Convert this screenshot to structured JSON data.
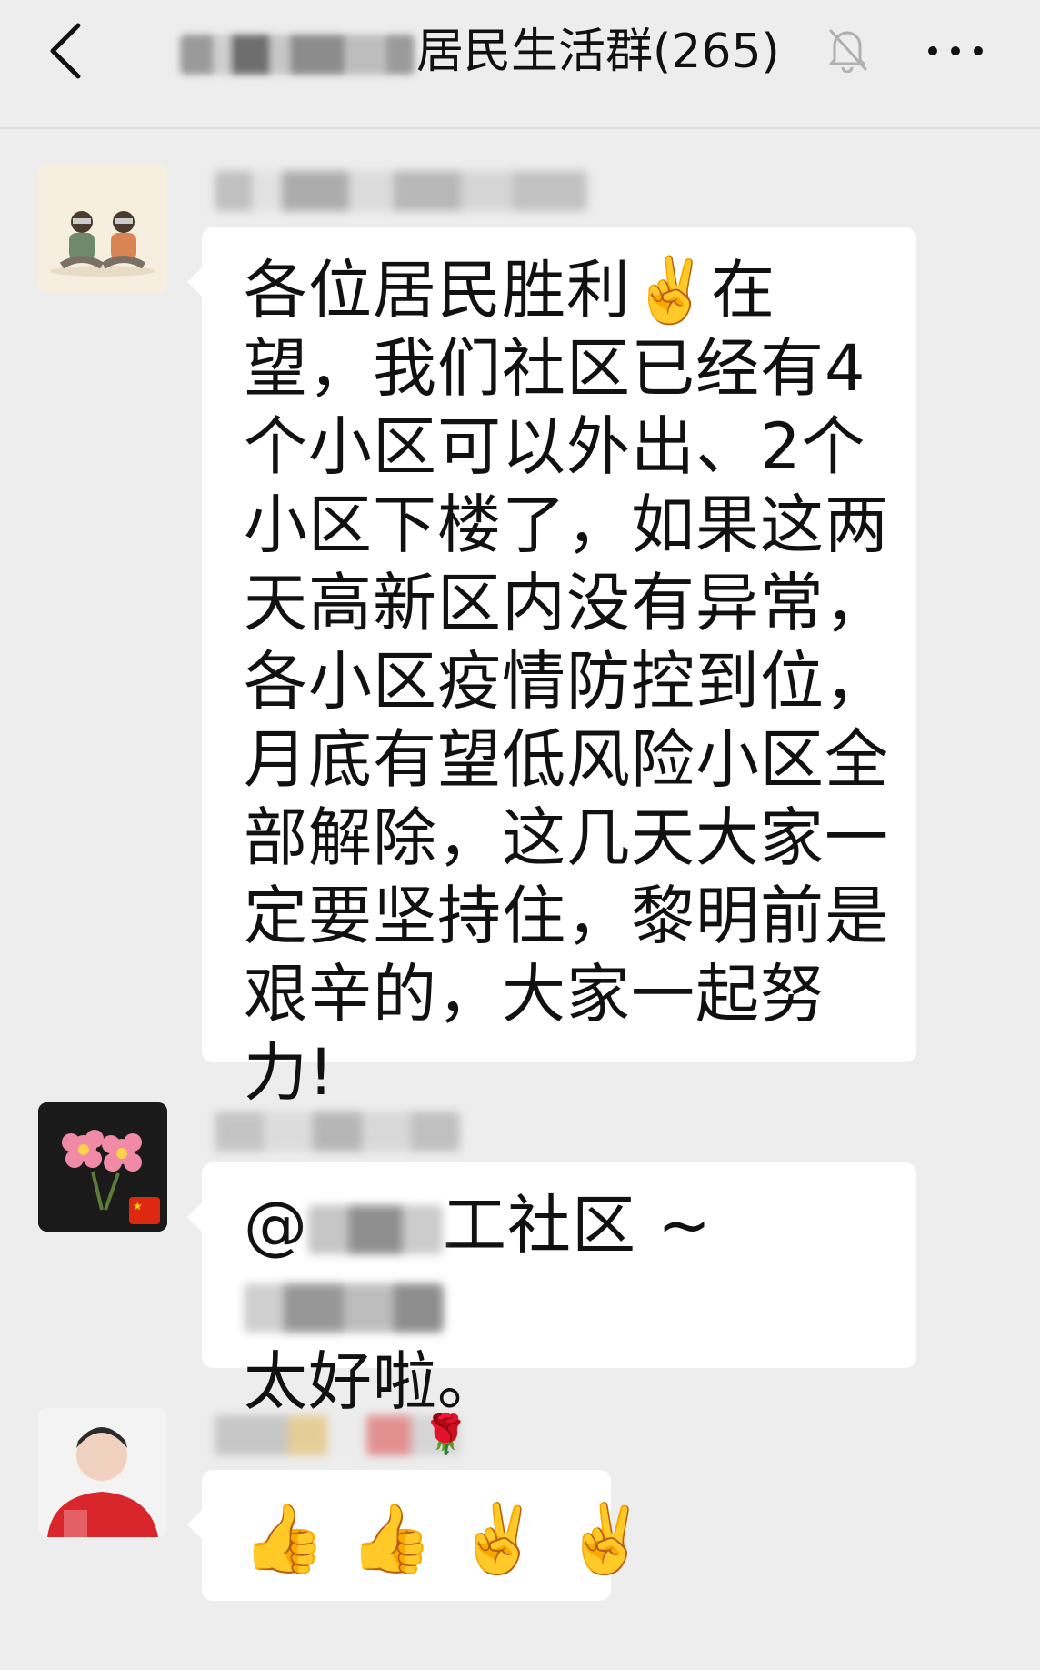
{
  "header": {
    "title_visible": "居民生活群(265)",
    "title_prefix_blurred": true,
    "back_icon": "chevron-left-icon",
    "mute_icon": "bell-off-icon",
    "more_icon": "more-horizontal-icon"
  },
  "messages": [
    {
      "sender_name_blurred": true,
      "avatar_icon": "cartoon-two-people-avatar",
      "text": "各位居民胜利✌️在望，我们社区已经有4个小区可以外出、2个小区下楼了，如果这两天高新区内没有异常，各小区疫情防控到位，月底有望低风险小区全部解除，这几天大家一定要坚持住，黎明前是艰辛的，大家一起努力!"
    },
    {
      "sender_name_blurred": true,
      "avatar_icon": "pink-flowers-avatar",
      "mention_prefix": "@",
      "mention_visible_part": "工社区",
      "mention_suffix": "~",
      "text_line2": "太好啦。"
    },
    {
      "sender_name_blurred": true,
      "sender_name_emoji": "🌹",
      "avatar_icon": "person-photo-avatar",
      "emojis": [
        "👍",
        "👍",
        "✌️",
        "✌️"
      ]
    }
  ],
  "colors": {
    "background": "#ededed",
    "bubble": "#ffffff",
    "text": "#111111"
  }
}
